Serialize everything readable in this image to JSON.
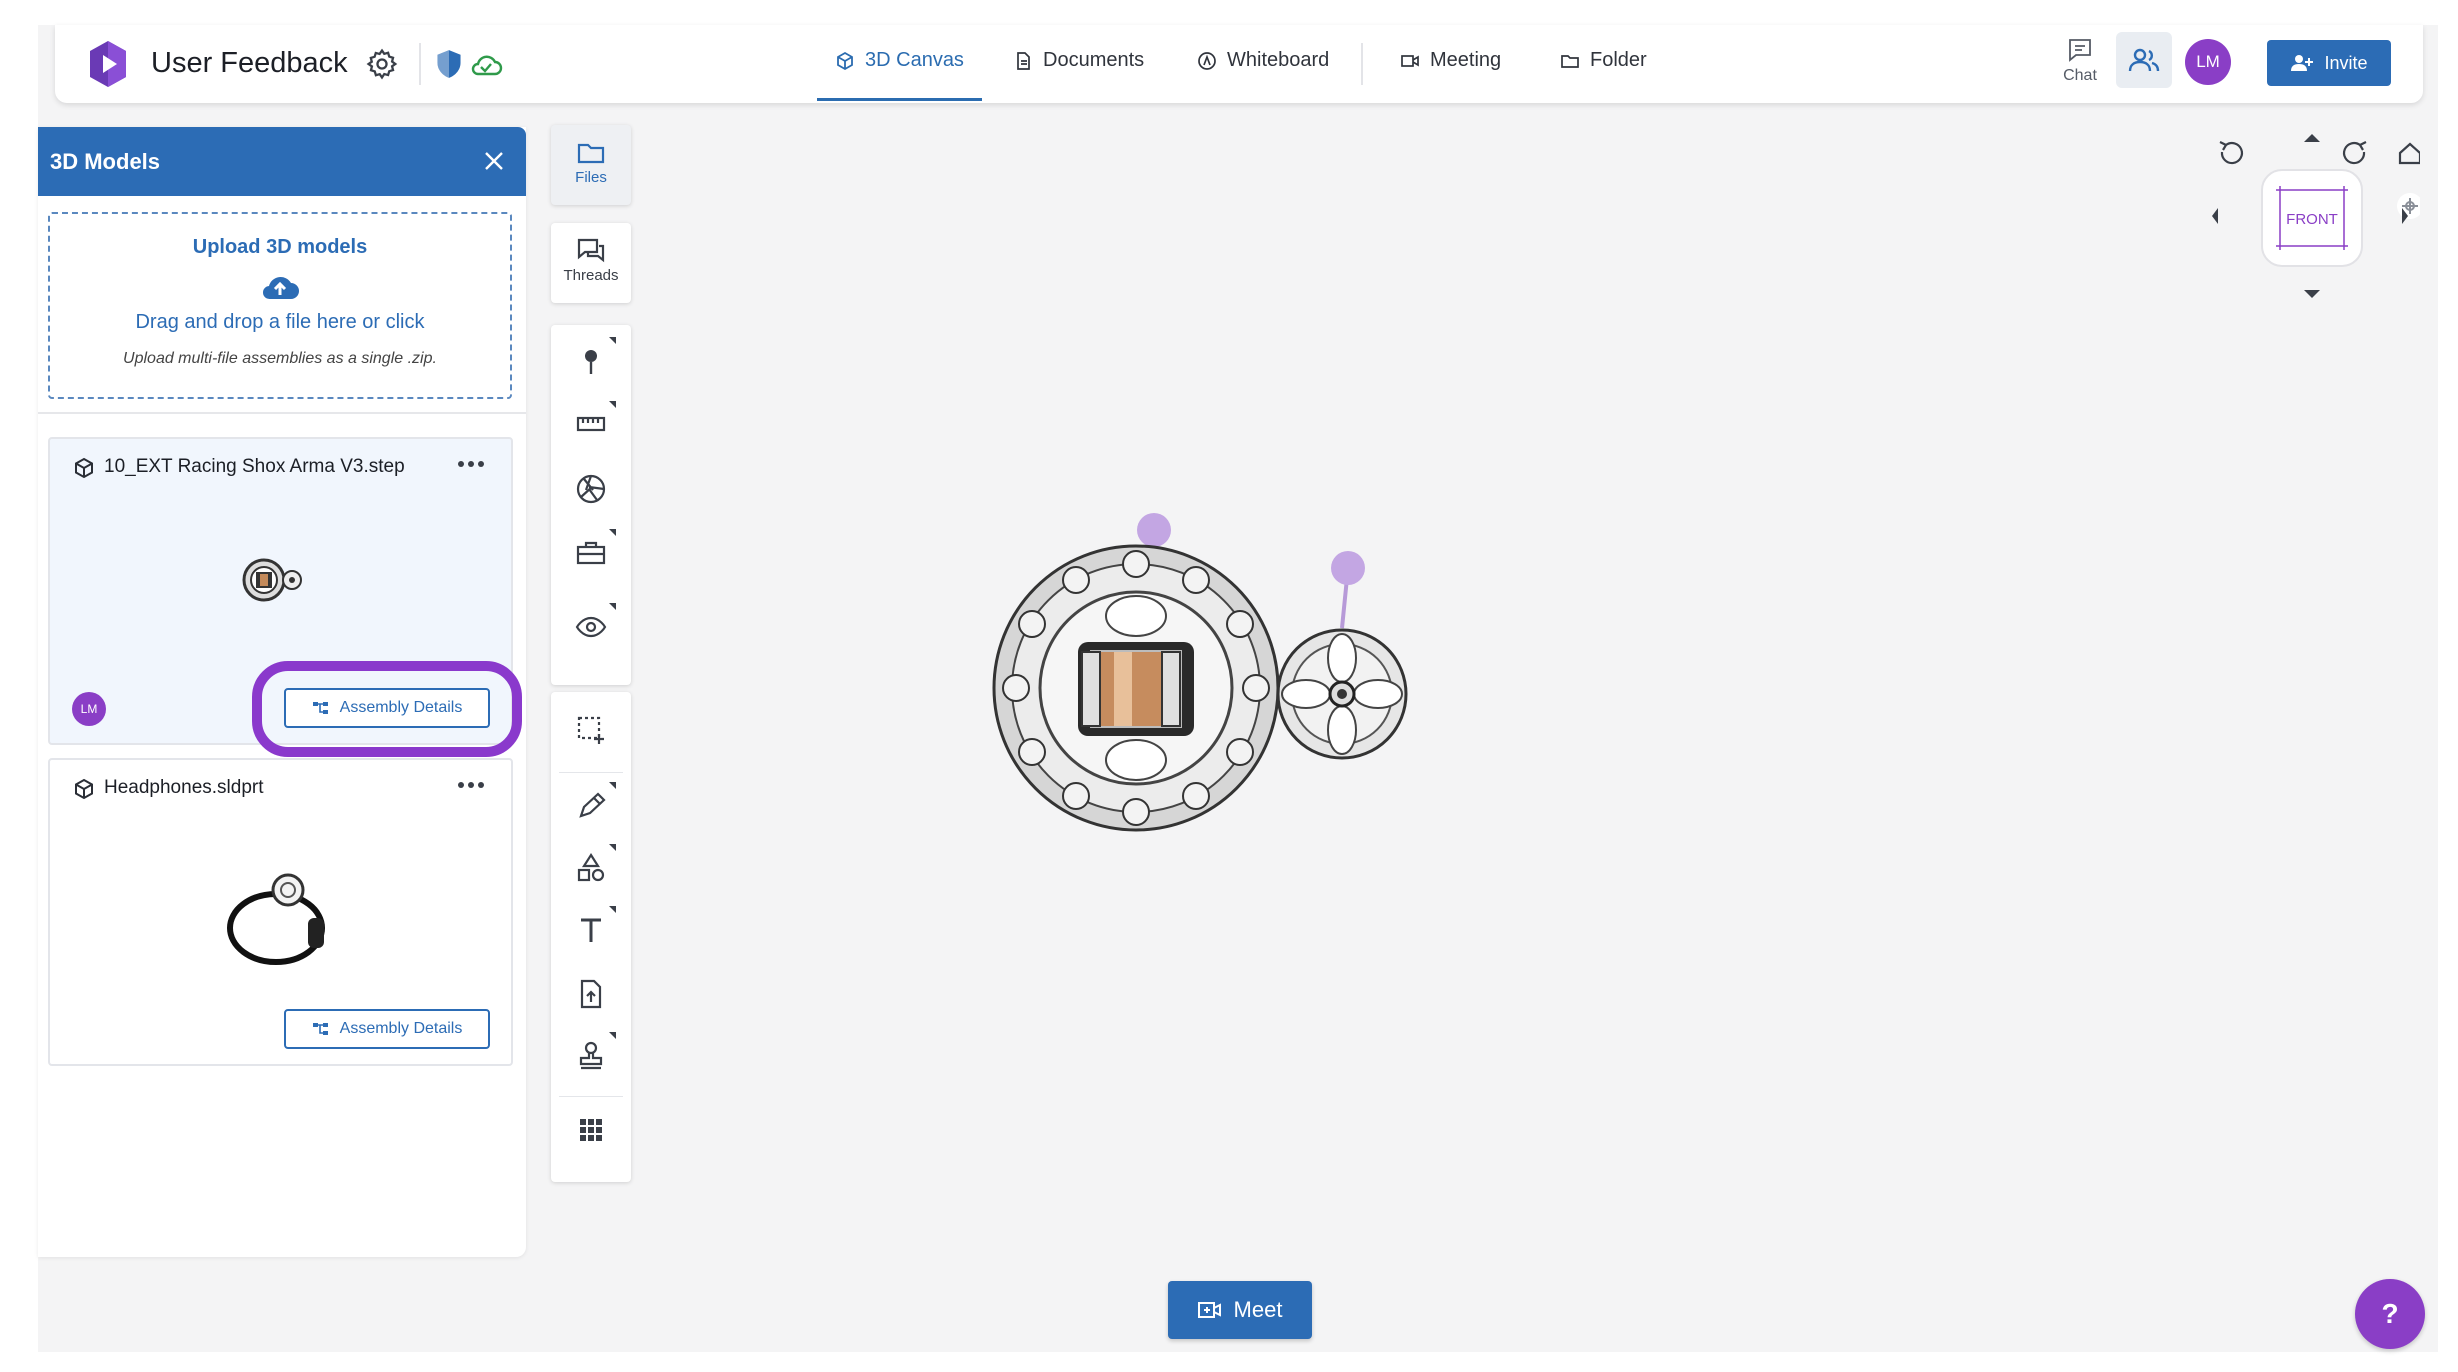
{
  "header": {
    "app_title": "User Feedback",
    "tabs": [
      {
        "label": "3D Canvas",
        "icon": "cube-icon",
        "active": true
      },
      {
        "label": "Documents",
        "icon": "document-icon",
        "active": false
      },
      {
        "label": "Whiteboard",
        "icon": "whiteboard-icon",
        "active": false
      },
      {
        "label": "Meeting",
        "icon": "video-icon",
        "active": false
      },
      {
        "label": "Folder",
        "icon": "folder-icon",
        "active": false
      }
    ],
    "chat_label": "Chat",
    "user_initials": "LM",
    "invite_label": "Invite"
  },
  "panel": {
    "title": "3D Models",
    "upload": {
      "title": "Upload 3D models",
      "text": "Drag and drop a file here or click",
      "hint": "Upload multi-file assemblies as a single .zip."
    },
    "models": [
      {
        "name": "10_EXT Racing Shox Arma V3.step",
        "button": "Assembly Details",
        "owner_initials": "LM",
        "selected": true
      },
      {
        "name": "Headphones.sldprt",
        "button": "Assembly Details",
        "owner_initials": "",
        "selected": false
      }
    ]
  },
  "rail": {
    "files_label": "Files",
    "threads_label": "Threads"
  },
  "viewcube": {
    "face_label": "FRONT"
  },
  "meet_label": "Meet",
  "help_label": "?",
  "colors": {
    "brand_blue": "#2c6cb5",
    "accent_purple": "#8a3ec6",
    "highlight_ring": "#8a39cc"
  }
}
